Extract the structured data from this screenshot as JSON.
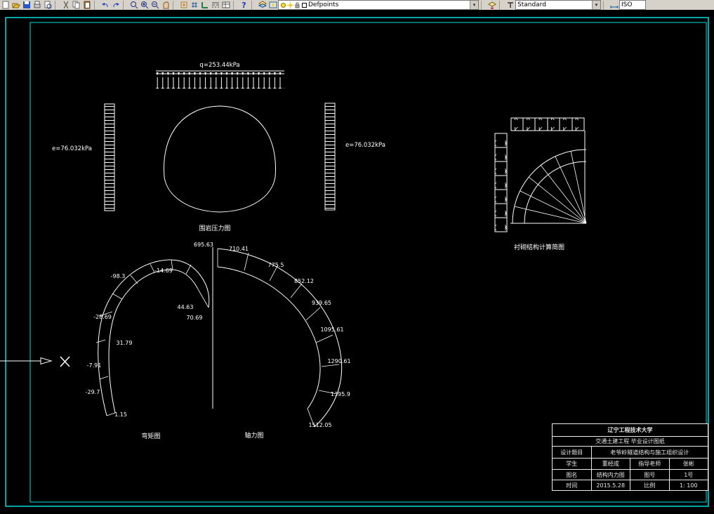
{
  "toolbar": {
    "layer_value": "Defpoints",
    "style_value": "Standard",
    "dim_style_value": "ISO",
    "dropdown_arrow": "▾"
  },
  "pressure_diagram": {
    "top_load_label": "q=253.44kPa",
    "left_pressure_label": "e=76.032kPa",
    "right_pressure_label": "e=76.032kPa",
    "caption": "围岩压力图"
  },
  "lining_diagram": {
    "caption": "衬砌结构计算简图"
  },
  "moment_diagram": {
    "caption": "弯矩图",
    "values": [
      "-98.3",
      "-14.69",
      "-28.69",
      "31.79",
      "-7.91",
      "-29.7",
      "1.15",
      "44.63",
      "70.69"
    ]
  },
  "axial_diagram": {
    "caption": "轴力图",
    "values": [
      "695.63",
      "710.41",
      "775.5",
      "852.12",
      "939.65",
      "1095.61",
      "1290.61",
      "1395.9",
      "1512.05"
    ]
  },
  "title_block": {
    "university": "辽宁工程技术大学",
    "subtitle": "交通土建工程 毕业设计图纸",
    "design_title_label": "设计题目",
    "design_title_value": "老爷岭隧道结构与施工组织设计",
    "student_label": "学生",
    "student_value": "董经成",
    "advisor_label": "指导老师",
    "advisor_value": "张彬",
    "drawing_name_label": "图名",
    "drawing_name_value": "结构内力图",
    "drawing_no_label": "图号",
    "drawing_no_value": "1号",
    "date_label": "时间",
    "date_value": "2015.5.28",
    "scale_label": "比例",
    "scale_value": "1: 100"
  }
}
